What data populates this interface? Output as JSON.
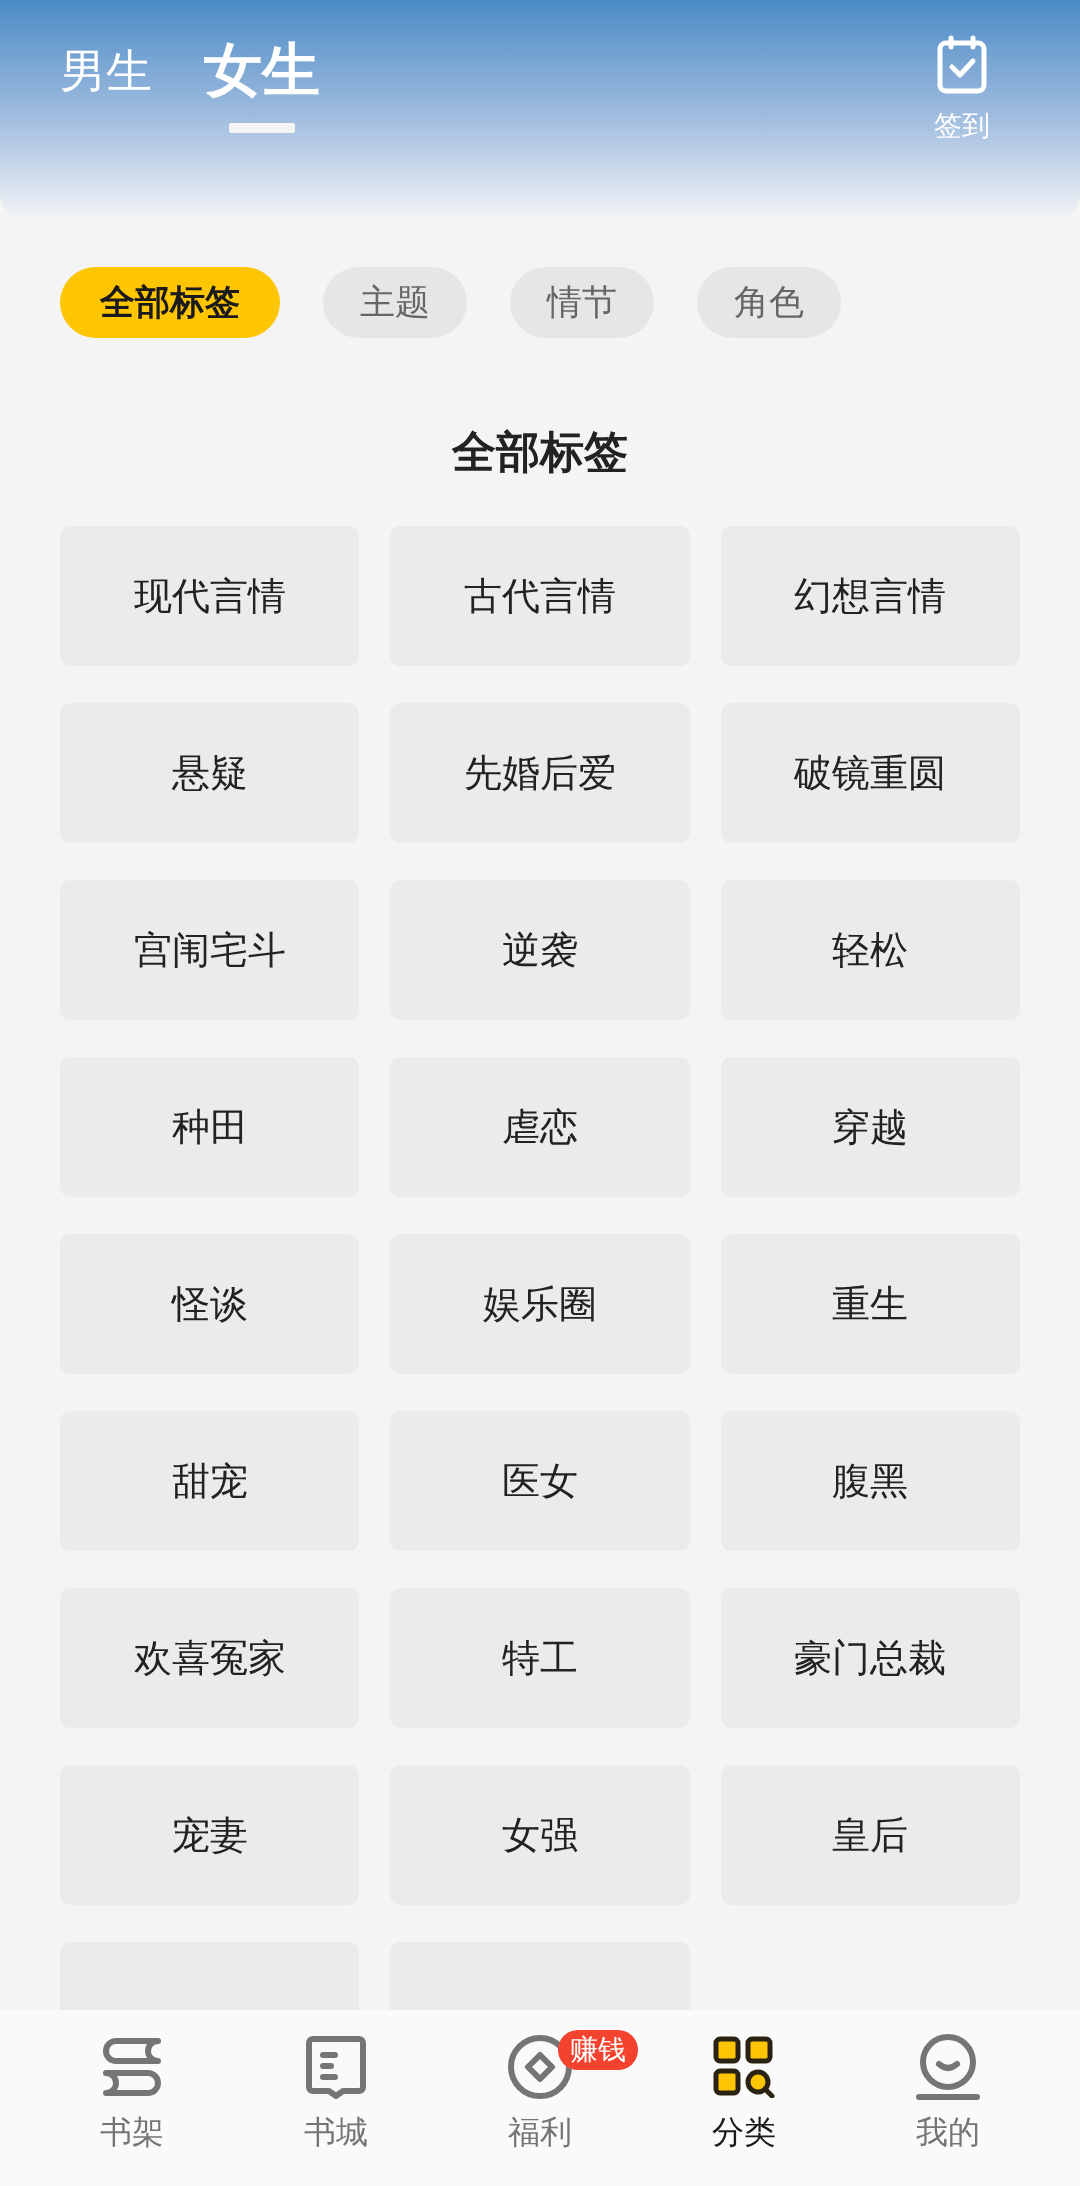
{
  "top_tabs": [
    {
      "label": "男生",
      "selected": false
    },
    {
      "label": "女生",
      "selected": true
    }
  ],
  "sign_in": {
    "label": "签到"
  },
  "filter_chips": [
    {
      "label": "全部标签",
      "selected": true
    },
    {
      "label": "主题",
      "selected": false
    },
    {
      "label": "情节",
      "selected": false
    },
    {
      "label": "角色",
      "selected": false
    }
  ],
  "section_title": "全部标签",
  "tags": [
    "现代言情",
    "古代言情",
    "幻想言情",
    "悬疑",
    "先婚后爱",
    "破镜重圆",
    "宫闱宅斗",
    "逆袭",
    "轻松",
    "种田",
    "虐恋",
    "穿越",
    "怪谈",
    "娱乐圈",
    "重生",
    "甜宠",
    "医女",
    "腹黑",
    "欢喜冤家",
    "特工",
    "豪门总裁",
    "宠妻",
    "女强",
    "皇后"
  ],
  "bottom_nav": [
    {
      "kind": "shelf",
      "label": "书架",
      "selected": false
    },
    {
      "kind": "store",
      "label": "书城",
      "selected": false
    },
    {
      "kind": "welfare",
      "label": "福利",
      "selected": false,
      "badge": "赚钱"
    },
    {
      "kind": "category",
      "label": "分类",
      "selected": true
    },
    {
      "kind": "me",
      "label": "我的",
      "selected": false
    }
  ]
}
